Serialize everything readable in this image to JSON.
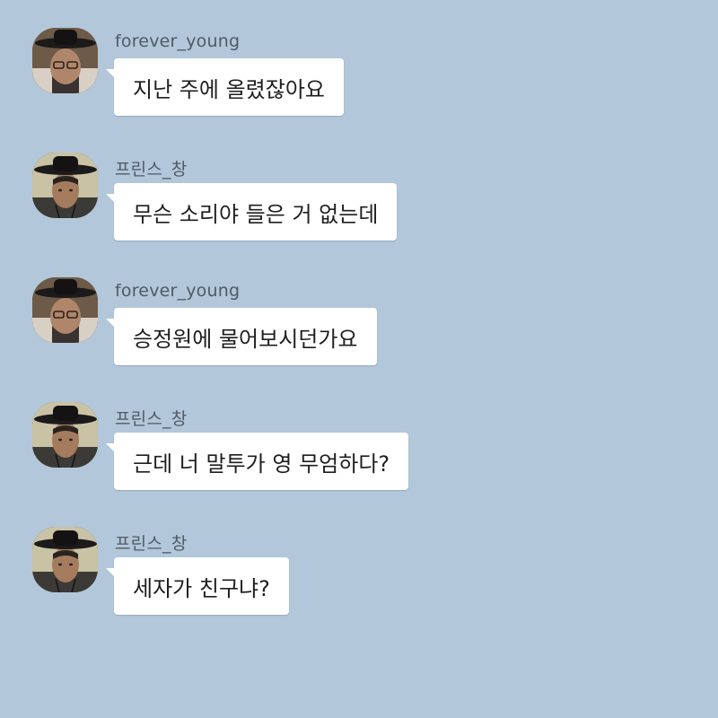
{
  "chat": {
    "messages": [
      {
        "sender": "forever_young",
        "avatar_icon": "man-with-glasses-gat-avatar",
        "text": "지난 주에 올렸잖아요"
      },
      {
        "sender": "프린스_창",
        "avatar_icon": "young-man-gat-avatar",
        "text": "무슨 소리야 들은 거 없는데"
      },
      {
        "sender": "forever_young",
        "avatar_icon": "man-with-glasses-gat-avatar",
        "text": "승정원에 물어보시던가요"
      },
      {
        "sender": "프린스_창",
        "avatar_icon": "young-man-gat-avatar",
        "text": "근데 너 말투가 영 무엄하다?"
      },
      {
        "sender": "프린스_창",
        "avatar_icon": "young-man-gat-avatar",
        "text": "세자가 친구냐?"
      }
    ]
  },
  "colors": {
    "background": "#b2c7d9",
    "bubble": "#ffffff",
    "sender_text": "#505a66",
    "message_text": "#1f1f1f"
  }
}
